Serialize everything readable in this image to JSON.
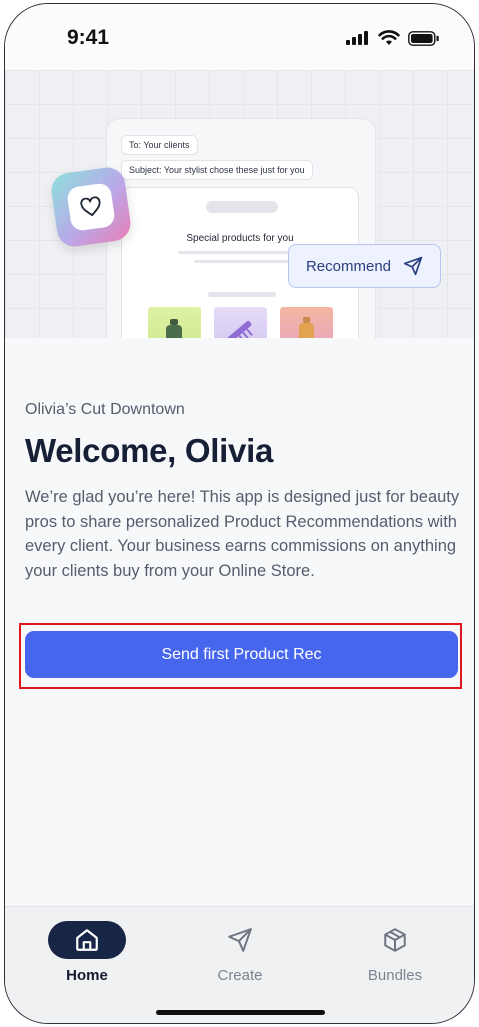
{
  "status_bar": {
    "time": "9:41"
  },
  "hero": {
    "to_line": "To: Your clients",
    "subject_line": "Subject: Your stylist chose these just for you",
    "card_heading": "Special products for you",
    "recommend_label": "Recommend",
    "icons": [
      "heart-icon",
      "send-icon"
    ]
  },
  "main": {
    "store_name": "Olivia’s Cut Downtown",
    "title": "Welcome, Olivia",
    "description": "We’re glad you’re here! This app is designed just for beauty pros to share personalized Product Recommendations with every client. Your business earns commissions on anything your clients buy from your Online Store.",
    "cta_label": "Send first Product Rec"
  },
  "tab_bar": {
    "tabs": [
      {
        "label": "Home",
        "icon": "home-icon",
        "active": true
      },
      {
        "label": "Create",
        "icon": "send-icon",
        "active": false
      },
      {
        "label": "Bundles",
        "icon": "box-icon",
        "active": false
      }
    ]
  },
  "colors": {
    "accent": "#4766ee",
    "active_tab": "#172647",
    "highlight": "#e0141c"
  }
}
